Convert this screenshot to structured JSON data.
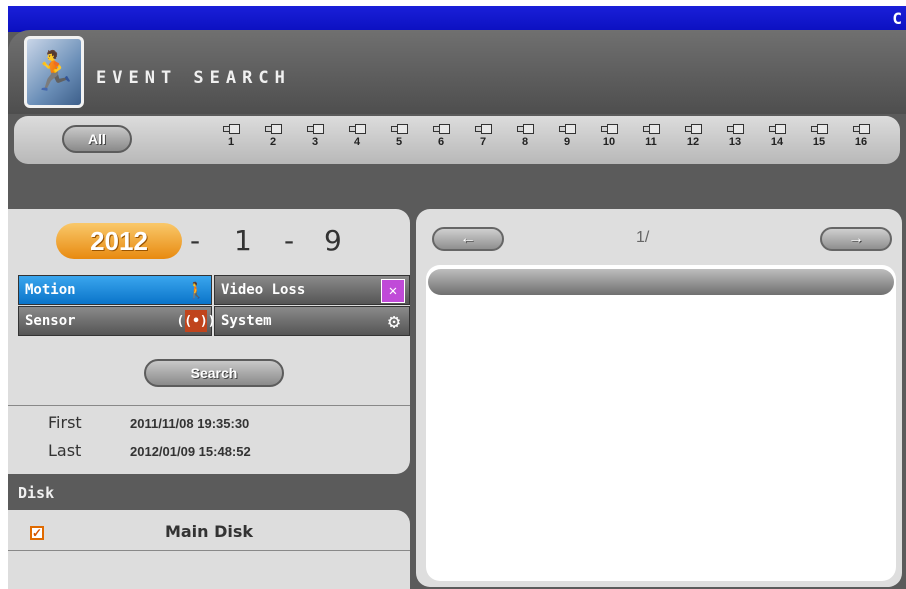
{
  "window": {
    "corner_text": "C"
  },
  "header": {
    "title": "EVENT SEARCH",
    "icon": "running-man-icon"
  },
  "channel_bar": {
    "all_label": "All",
    "channels": [
      "1",
      "2",
      "3",
      "4",
      "5",
      "6",
      "7",
      "8",
      "9",
      "10",
      "11",
      "12",
      "13",
      "14",
      "15",
      "16"
    ]
  },
  "date": {
    "year": "2012",
    "sep1": "-",
    "month": "1",
    "sep2": "-",
    "day": "9"
  },
  "event_types": [
    {
      "label": "Motion",
      "icon": "running-man-icon",
      "active": true
    },
    {
      "label": "Video Loss",
      "icon": "monitor-x-icon",
      "active": false
    },
    {
      "label": "Sensor",
      "icon": "sensor-signal-icon",
      "active": false
    },
    {
      "label": "System",
      "icon": "gear-icon",
      "active": false
    }
  ],
  "search_label": "Search",
  "record_range": {
    "first_label": "First",
    "first_value": "2011/11/08 19:35:30",
    "last_label": "Last",
    "last_value": "2012/01/09 15:48:52"
  },
  "disk": {
    "section_label": "Disk",
    "name": "Main Disk",
    "checked": true
  },
  "results": {
    "page_indicator": "1/",
    "prev": "←",
    "next": "→"
  },
  "colors": {
    "accent_orange": "#e88a10",
    "active_blue": "#0b74c9",
    "title_bar": "#0b10c0"
  }
}
